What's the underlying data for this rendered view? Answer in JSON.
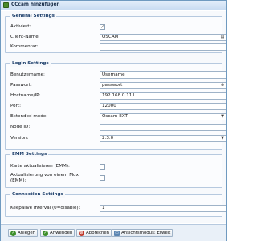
{
  "window": {
    "title": "CCcam hinzufügen"
  },
  "general": {
    "legend": "General Settings",
    "enabled_label": "Aktiviert:",
    "enabled_checked": true,
    "client_name_label": "Client-Name:",
    "client_name_value": "OSCAM",
    "comment_label": "Kommentar:",
    "comment_value": ""
  },
  "login": {
    "legend": "Login Settings",
    "username_label": "Benutzername:",
    "username_value": "Username",
    "password_label": "Passwort:",
    "password_value": "passwort",
    "host_label": "Hostname/IP:",
    "host_value": "192.168.0.111",
    "port_label": "Port:",
    "port_value": "12000",
    "extended_label": "Extended mode:",
    "extended_value": "Oscam-EXT",
    "nodeid_label": "Node ID:",
    "nodeid_value": "",
    "version_label": "Version:",
    "version_value": "2.3.0"
  },
  "emm": {
    "legend": "EMM Settings",
    "card_update_label": "Karte aktualisieren (EMM):",
    "card_update_checked": false,
    "other_mux_label": "Aktualisierung von einem Mux (EMM):",
    "other_mux_checked": false
  },
  "connection": {
    "legend": "Connection Settings",
    "keepalive_label": "Keepalive interval (0=disable):",
    "keepalive_value": "1"
  },
  "footer": {
    "create": "Anlegen",
    "apply": "Anwenden",
    "cancel": "Abbrechen",
    "view_mode": "Ansichtsmodus: Erweit"
  },
  "colors": {
    "accent": "#1d3f6b",
    "ok_green": "#3d8f2a",
    "cancel_red": "#c0392b"
  }
}
